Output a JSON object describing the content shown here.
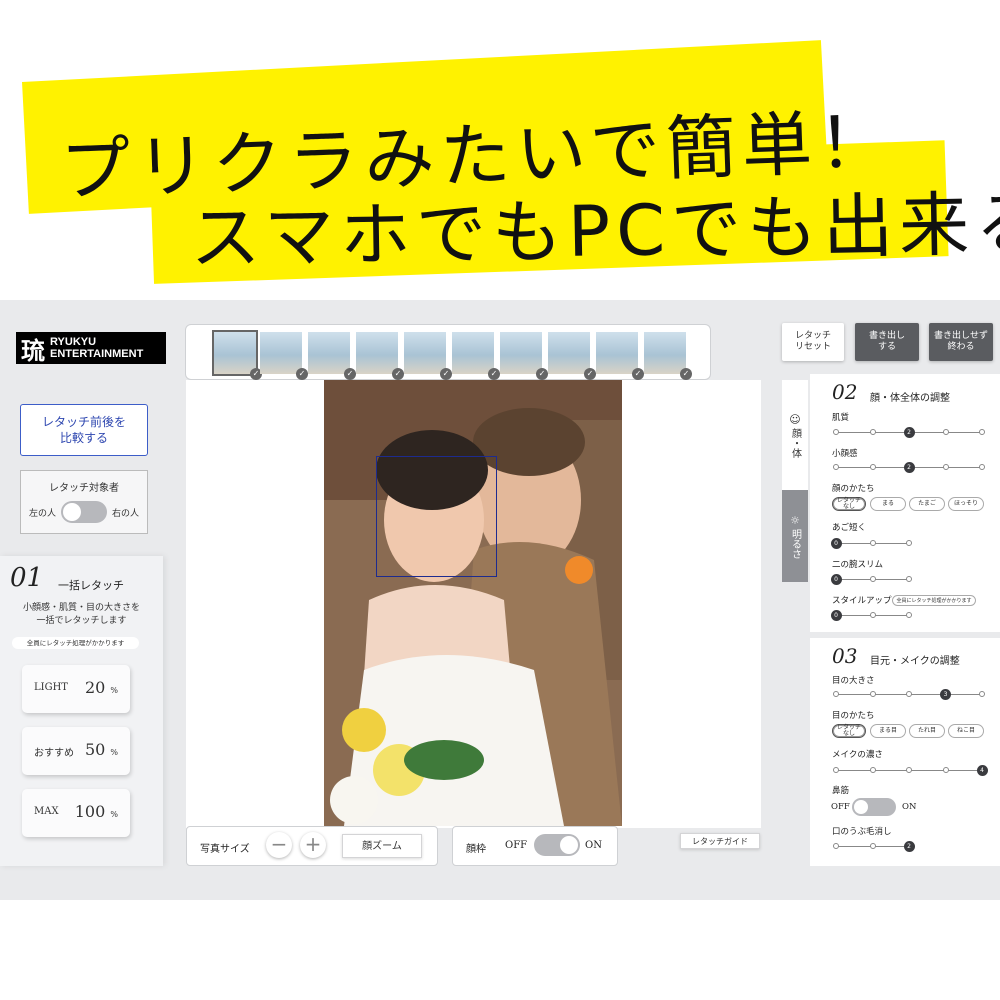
{
  "headline": {
    "line1": "プリクラみたいで簡単！",
    "line2": "スマホでもPCでも出来る"
  },
  "logo": {
    "mark": "琉",
    "line1": "RYUKYU",
    "line2": "ENTERTAINMENT"
  },
  "colors": {
    "banner": "#fff200",
    "accent_blue": "#3c5dc8",
    "dark_button": "#5a5c60",
    "facebox": "#1d2b8f"
  },
  "thumbnails": {
    "count": 10,
    "selected_index": 0,
    "check_icon": "check-icon"
  },
  "left": {
    "compare_button": "レタッチ前後を\n比較する",
    "target": {
      "title": "レタッチ対象者",
      "left_label": "左の人",
      "right_label": "右の人"
    }
  },
  "batch": {
    "number": "01",
    "title": "一括レタッチ",
    "description": "小顔感・肌質・目の大きさを\n一括でレタッチします",
    "note": "全員にレタッチ処理がかかります",
    "presets": [
      {
        "label": "LIGHT",
        "value": "20",
        "unit": "%"
      },
      {
        "label": "おすすめ",
        "value": "50",
        "unit": "%"
      },
      {
        "label": "MAX",
        "value": "100",
        "unit": "%"
      }
    ]
  },
  "bottom": {
    "photo_size": "写真サイズ",
    "minus": "−",
    "plus": "+",
    "face_zoom": "顔ズーム",
    "face_frame": "顔枠",
    "off": "OFF",
    "on": "ON",
    "guide": "レタッチガイド"
  },
  "top_buttons": {
    "reset": "レタッチ\nリセット",
    "export": "書き出し\nする",
    "finish": "書き出しせず\n終わる"
  },
  "tabs": {
    "face_body": "顔・体",
    "brightness": "明るさ",
    "face_icon": "smile-icon",
    "sun_icon": "sun-icon"
  },
  "section2": {
    "number": "02",
    "title": "顔・体全体の調整",
    "skin": {
      "label": "肌質",
      "active": 3,
      "value": "2"
    },
    "small_face": {
      "label": "小顔感",
      "active": 3,
      "value": "2"
    },
    "face_shape": {
      "label": "顔のかたち",
      "options": [
        "レタッチ\nなし",
        "まる",
        "たまご",
        "ほっそり"
      ],
      "selected": 0
    },
    "chin": {
      "label": "あご短く",
      "active": 1,
      "value": "0"
    },
    "arm": {
      "label": "二の腕スリム",
      "active": 1,
      "value": "0"
    },
    "style": {
      "label": "スタイルアップ",
      "note": "全員にレタッチ処理がかかります",
      "active": 1,
      "value": "0"
    }
  },
  "section3": {
    "number": "03",
    "title": "目元・メイクの調整",
    "eye_size": {
      "label": "目の大きさ",
      "active": 4,
      "value": "3"
    },
    "eye_shape": {
      "label": "目のかたち",
      "options": [
        "レタッチ\nなし",
        "まる目",
        "たれ目",
        "ねこ目"
      ],
      "selected": 0
    },
    "makeup": {
      "label": "メイクの濃さ",
      "active": 5,
      "value": "4"
    },
    "nose": {
      "label": "鼻筋",
      "off": "OFF",
      "on": "ON"
    },
    "mouth": {
      "label": "口のうぶ毛消し",
      "active": 3,
      "value": "2"
    }
  }
}
